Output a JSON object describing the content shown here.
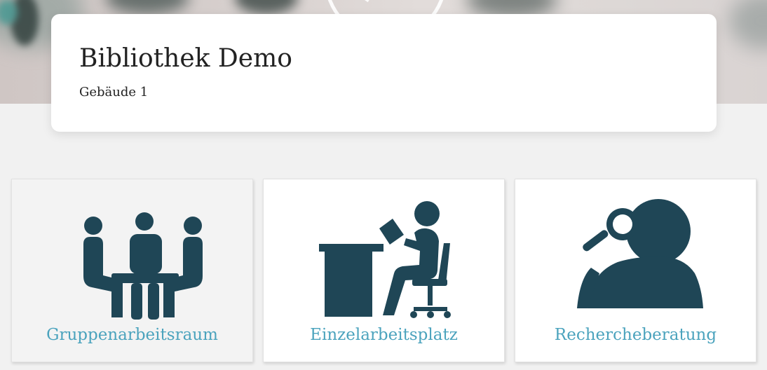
{
  "header": {
    "title": "Bibliothek Demo",
    "subtitle": "Gebäude 1"
  },
  "categories": [
    {
      "label": "Gruppenarbeitsraum",
      "icon": "group-table-icon"
    },
    {
      "label": "Einzelarbeitsplatz",
      "icon": "desk-reader-icon"
    },
    {
      "label": "Rechercheberatung",
      "icon": "magnifier-person-icon"
    }
  ],
  "colors": {
    "icon": "#1f4656",
    "label": "#4ba3bd",
    "background": "#f1f1f1",
    "card": "#ffffff"
  }
}
